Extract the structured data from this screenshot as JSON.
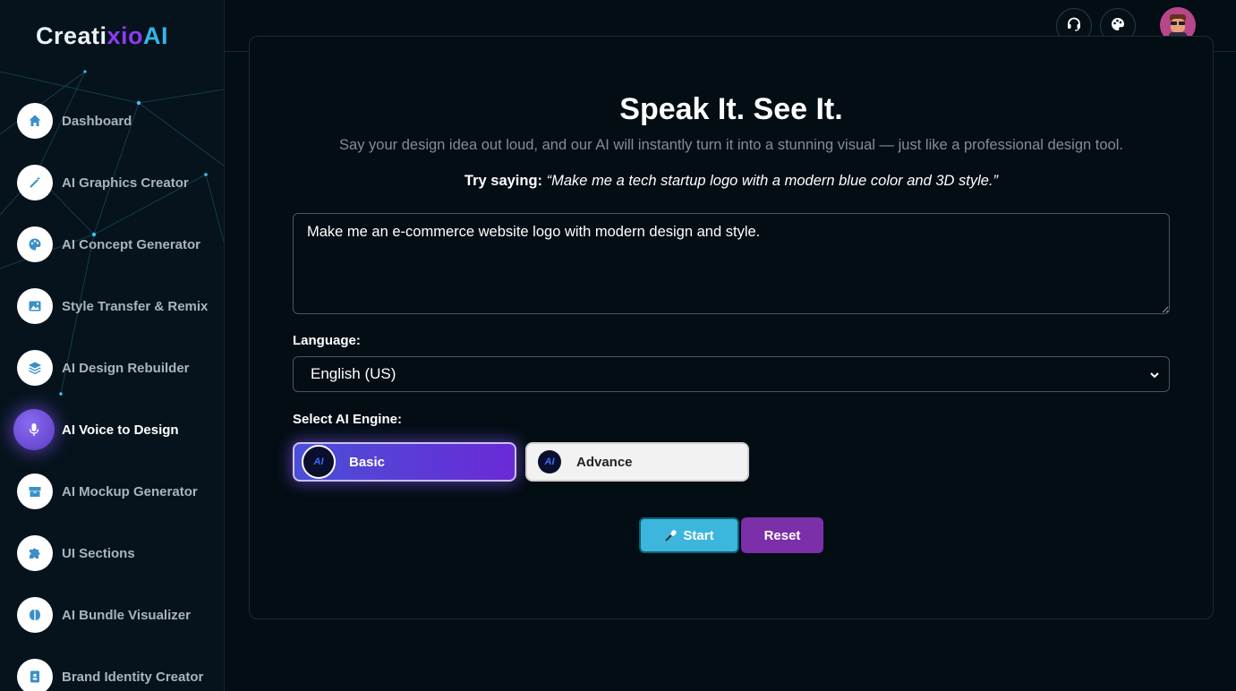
{
  "app": {
    "logo": {
      "part1": "Creati",
      "part2": "xio",
      "part3": "AI"
    }
  },
  "sidebar": {
    "items": [
      {
        "label": "Dashboard",
        "icon": "home-icon"
      },
      {
        "label": "AI Graphics Creator",
        "icon": "magic-wand-icon"
      },
      {
        "label": "AI Concept Generator",
        "icon": "palette-icon"
      },
      {
        "label": "Style Transfer & Remix",
        "icon": "image-icon"
      },
      {
        "label": "AI Design Rebuilder",
        "icon": "layers-icon"
      },
      {
        "label": "AI Voice to Design",
        "icon": "microphone-icon",
        "active": true
      },
      {
        "label": "AI Mockup Generator",
        "icon": "box-icon"
      },
      {
        "label": "UI Sections",
        "icon": "puzzle-icon"
      },
      {
        "label": "AI Bundle Visualizer",
        "icon": "brain-icon"
      },
      {
        "label": "Brand Identity Creator",
        "icon": "id-badge-icon"
      }
    ]
  },
  "header": {
    "support_icon": "headset-icon",
    "theme_icon": "palette-icon",
    "avatar": "user-avatar"
  },
  "main": {
    "title": "Speak It. See It.",
    "subtitle": "Say your design idea out loud, and our AI will instantly turn it into a stunning visual — just like a professional design tool.",
    "try_label": "Try saying:",
    "try_example": "“Make me a tech startup logo with a modern blue color and 3D style.”",
    "prompt_value": "Make me an e-commerce website logo with modern design and style.",
    "language_label": "Language:",
    "language_selected": "English (US)",
    "engine_label": "Select AI Engine:",
    "engines": [
      {
        "label": "Basic",
        "selected": true,
        "badge": "AI"
      },
      {
        "label": "Advance",
        "selected": false,
        "badge": "AI"
      }
    ],
    "start_label": "Start",
    "reset_label": "Reset"
  },
  "colors": {
    "background": "#030d14",
    "accent_purple": "#6a2ad6",
    "start_button": "#3cb6dc",
    "reset_button": "#7b2fa8"
  }
}
